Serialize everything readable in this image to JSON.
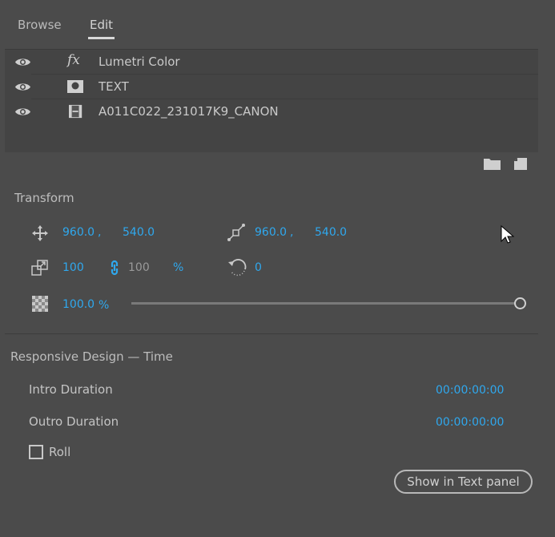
{
  "tabs": [
    {
      "label": "Browse"
    },
    {
      "label": "Edit",
      "active": true
    }
  ],
  "layers": [
    {
      "name": "Lumetri Color",
      "icon": "fx-icon",
      "icon_text": "fx"
    },
    {
      "name": "TEXT",
      "icon": "shape-layer-icon"
    },
    {
      "name": "A011C022_231017K9_CANON",
      "icon": "film-clip-icon"
    }
  ],
  "transform": {
    "title": "Transform",
    "position": {
      "x": "960.0",
      "sep": ",",
      "y": "540.0"
    },
    "anchor": {
      "x": "960.0",
      "sep": ",",
      "y": "540.0"
    },
    "scale": {
      "w": "100",
      "h": "100",
      "unit": "%"
    },
    "rotation": "0",
    "opacity": {
      "value": "100.0",
      "unit": "%",
      "fraction": 1.0
    }
  },
  "responsive": {
    "title": "Responsive Design — Time",
    "intro_label": "Intro Duration",
    "intro_value": "00:00:00:00",
    "outro_label": "Outro Duration",
    "outro_value": "00:00:00:00",
    "roll_label": "Roll",
    "roll_checked": false,
    "button": "Show in Text panel"
  },
  "colors": {
    "accent": "#2fa8ee",
    "bg": "#4b4b4b"
  }
}
